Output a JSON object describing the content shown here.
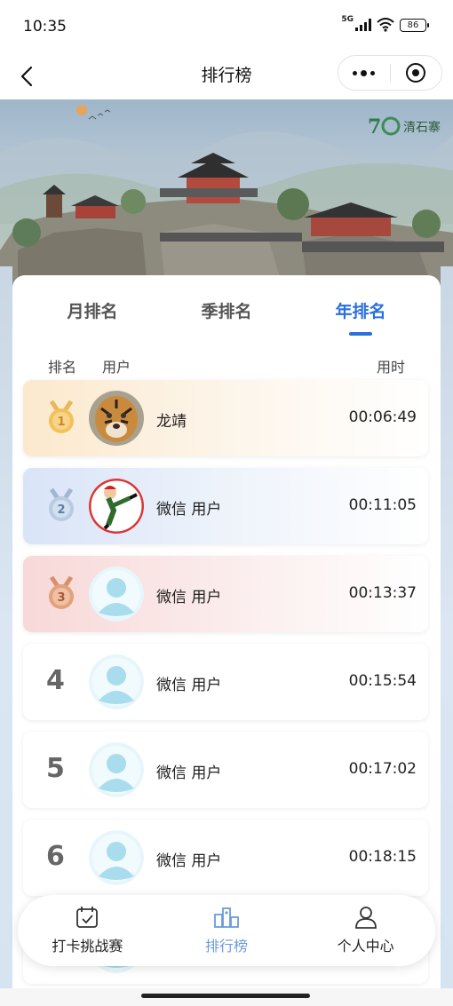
{
  "status_bar": {
    "time": "10:35",
    "network": "5G",
    "battery": "86"
  },
  "nav": {
    "title": "排行榜",
    "back_icon": "chevron-left-icon",
    "more_icon": "more-dots-icon",
    "close_icon": "target-circle-icon"
  },
  "banner": {
    "logo_text": "清石寨"
  },
  "tabs": [
    {
      "label": "月排名",
      "active": false
    },
    {
      "label": "季排名",
      "active": false
    },
    {
      "label": "年排名",
      "active": true
    }
  ],
  "columns": {
    "rank": "排名",
    "user": "用户",
    "time": "用时"
  },
  "ranking": [
    {
      "rank": "1",
      "name": "龙靖",
      "time": "00:06:49",
      "avatar": "tiger-avatar"
    },
    {
      "rank": "2",
      "name": "微信 用户",
      "time": "00:11:05",
      "avatar": "kick-cartoon-avatar"
    },
    {
      "rank": "3",
      "name": "微信 用户",
      "time": "00:13:37",
      "avatar": "default-avatar"
    },
    {
      "rank": "4",
      "name": "微信 用户",
      "time": "00:15:54",
      "avatar": "default-avatar"
    },
    {
      "rank": "5",
      "name": "微信 用户",
      "time": "00:17:02",
      "avatar": "default-avatar"
    },
    {
      "rank": "6",
      "name": "微信 用户",
      "time": "00:18:15",
      "avatar": "default-avatar"
    }
  ],
  "tabbar": [
    {
      "label": "打卡挑战赛",
      "icon": "calendar-check-icon",
      "active": false
    },
    {
      "label": "排行榜",
      "icon": "ranking-icon",
      "active": true
    },
    {
      "label": "个人中心",
      "icon": "person-icon",
      "active": false
    }
  ],
  "colors": {
    "accent": "#2a6fdb",
    "tab_active": "#6c9be0",
    "gold_row": "#fbe9cd",
    "silver_row": "#d9e4f7",
    "bronze_row": "#f8d8d8"
  }
}
